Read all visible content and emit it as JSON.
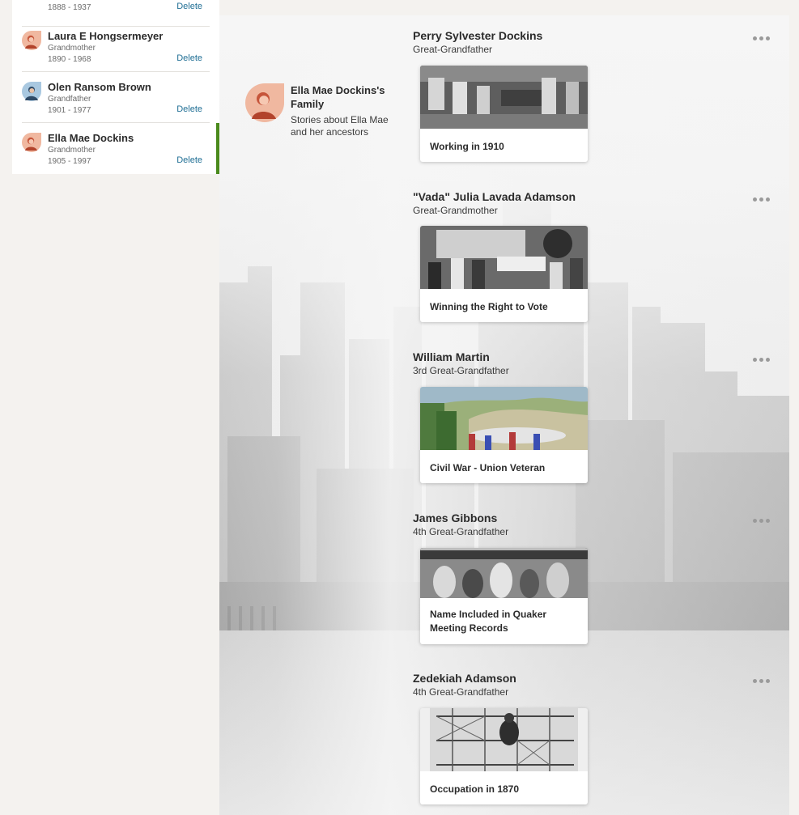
{
  "people": [
    {
      "name": "",
      "relation": "",
      "dates": "1888 - 1937",
      "delete_label": "Delete",
      "avatar": "woman-avatar-icon"
    },
    {
      "name": "Laura E Hongsermeyer",
      "relation": "Grandmother",
      "dates": "1890 - 1968",
      "delete_label": "Delete",
      "avatar": "woman-avatar-icon"
    },
    {
      "name": "Olen Ransom Brown",
      "relation": "Grandfather",
      "dates": "1901 - 1977",
      "delete_label": "Delete",
      "avatar": "man-avatar-icon"
    },
    {
      "name": "Ella Mae Dockins",
      "relation": "Grandmother",
      "dates": "1905 - 1997",
      "delete_label": "Delete",
      "avatar": "woman-avatar-icon"
    }
  ],
  "family": {
    "title": "Ella Mae Dockins's Family",
    "subtitle": "Stories about Ella Mae and her ancestors"
  },
  "ancestors": [
    {
      "name": "Perry Sylvester Dockins",
      "relation": "Great-Grandfather",
      "story": "Working in 1910"
    },
    {
      "name": "\"Vada\" Julia Lavada Adamson",
      "relation": "Great-Grandmother",
      "story": "Winning the Right to Vote"
    },
    {
      "name": "William Martin",
      "relation": "3rd Great-Grandfather",
      "story": "Civil War - Union Veteran"
    },
    {
      "name": "James Gibbons",
      "relation": "4th Great-Grandfather",
      "story": "Name Included in Quaker Meeting Records"
    },
    {
      "name": "Zedekiah Adamson",
      "relation": "4th Great-Grandfather",
      "story": "Occupation in 1870"
    }
  ],
  "colors": {
    "accent_selected": "#4a8a1c",
    "link": "#1f6e94",
    "woman_avatar_bg": "#f0b8a0",
    "man_avatar_bg": "#a9c8e0"
  }
}
